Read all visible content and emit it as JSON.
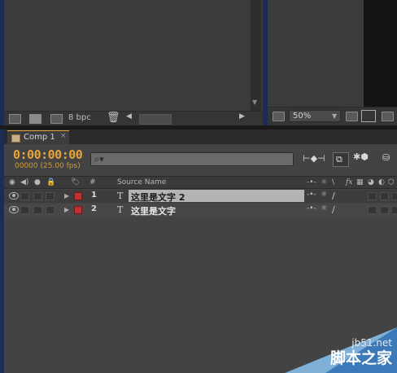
{
  "project_panel": {
    "bpc_label": "8 bpc"
  },
  "viewer": {
    "zoom": "50%"
  },
  "timeline": {
    "tab": {
      "label": "Comp 1",
      "close": "×"
    },
    "timecode": "0:00:00:00",
    "frame_info": "00000 (25.00 fps)",
    "search": {
      "value": "",
      "icon": "search-icon"
    },
    "columns": {
      "number": "#",
      "source_name": "Source Name",
      "fx": "fx"
    },
    "layers": [
      {
        "number": "1",
        "type_icon": "T",
        "name": "这里是文字 2",
        "label_color": "#c03232",
        "selected": true
      },
      {
        "number": "2",
        "type_icon": "T",
        "name": "这里是文字",
        "label_color": "#c03232",
        "selected": false
      }
    ]
  },
  "watermark": {
    "site": "jb51.net",
    "name": "脚本之家"
  },
  "colors": {
    "accent": "#e8a33a",
    "label_red": "#c03232"
  }
}
